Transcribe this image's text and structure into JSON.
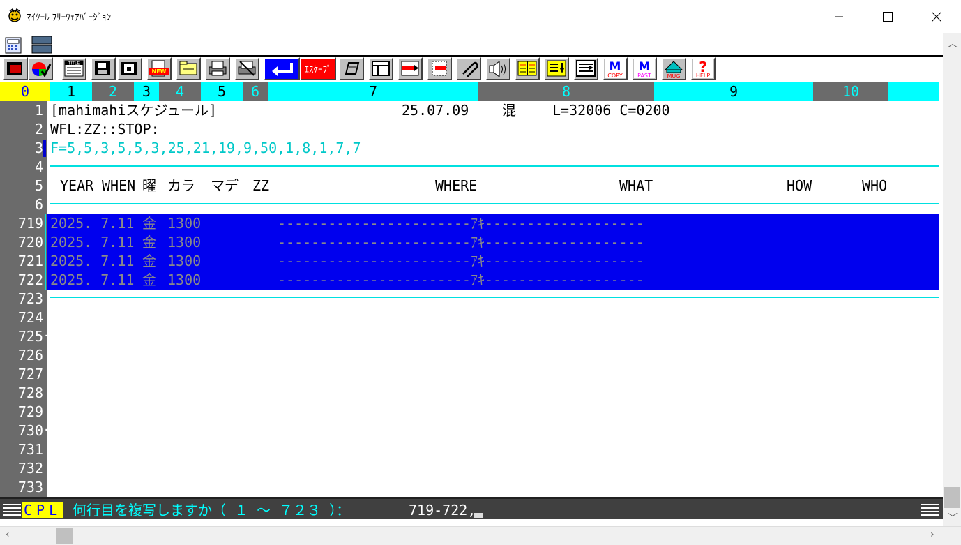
{
  "window": {
    "title": "ﾏｲﾂｰﾙ ﾌﾘｰｳｪｱﾊﾞｰｼﾞｮﾝ"
  },
  "iconbar": {
    "mark_copy_letter": "M",
    "mark_copy_label": "COPY",
    "mark_paste_letter": "M",
    "mark_paste_label": "PAST",
    "mug_label": "MUG",
    "help_symbol": "?",
    "help_label": "HELP",
    "escape_label": "ｴｽｹｰﾌﾟ",
    "new_label": "NEW",
    "title_label": "TITLE"
  },
  "ruler": [
    "0",
    "1",
    "2",
    "3",
    "4",
    "5",
    "6",
    "7",
    "8",
    "9",
    "10"
  ],
  "line_numbers": {
    "header": [
      "1",
      "2",
      "3",
      "4",
      "5",
      "6"
    ],
    "body": [
      "719",
      "720",
      "721",
      "722",
      "723",
      "724",
      "725",
      "726",
      "727",
      "728",
      "729",
      "730",
      "731",
      "732",
      "733"
    ]
  },
  "editor": {
    "line1_title": "[mahimahiスケジュール]",
    "line1_date": "25.07.09",
    "line1_mode": "混",
    "line1_pos": "L=32006 C=0200",
    "line2": "WFL:ZZ::STOP:",
    "line3": "F=5,5,3,5,5,3,25,21,19,9,50,1,8,1,7,7",
    "columns": {
      "year": "YEAR",
      "when": "WHEN",
      "day": "曜",
      "from": "カラ",
      "to": "マデ",
      "zz": "ZZ",
      "where": "WHERE",
      "what": "WHAT",
      "how": "HOW",
      "who": "WHO"
    },
    "rows": [
      {
        "date": "2025. 7.11",
        "day": "金",
        "time": "1300",
        "where": "-----------------------ｱｷ-------------------"
      },
      {
        "date": "2025. 7.11",
        "day": "金",
        "time": "1300",
        "where": "-----------------------ｱｷ-------------------"
      },
      {
        "date": "2025. 7.11",
        "day": "金",
        "time": "1300",
        "where": "-----------------------ｱｷ-------------------"
      },
      {
        "date": "2025. 7.11",
        "day": "金",
        "time": "1300",
        "where": "-----------------------ｱｷ-------------------"
      }
    ]
  },
  "status": {
    "mode": "CPL",
    "prompt": "何行目を複写しますか（ １ ～ ７２３ ）：",
    "input": "719-722,"
  },
  "colors": {
    "selection": "#0000ee",
    "cyan": "#00ffff",
    "gutter": "#6b6b6b",
    "ruler_yellow": "#ffff00"
  }
}
